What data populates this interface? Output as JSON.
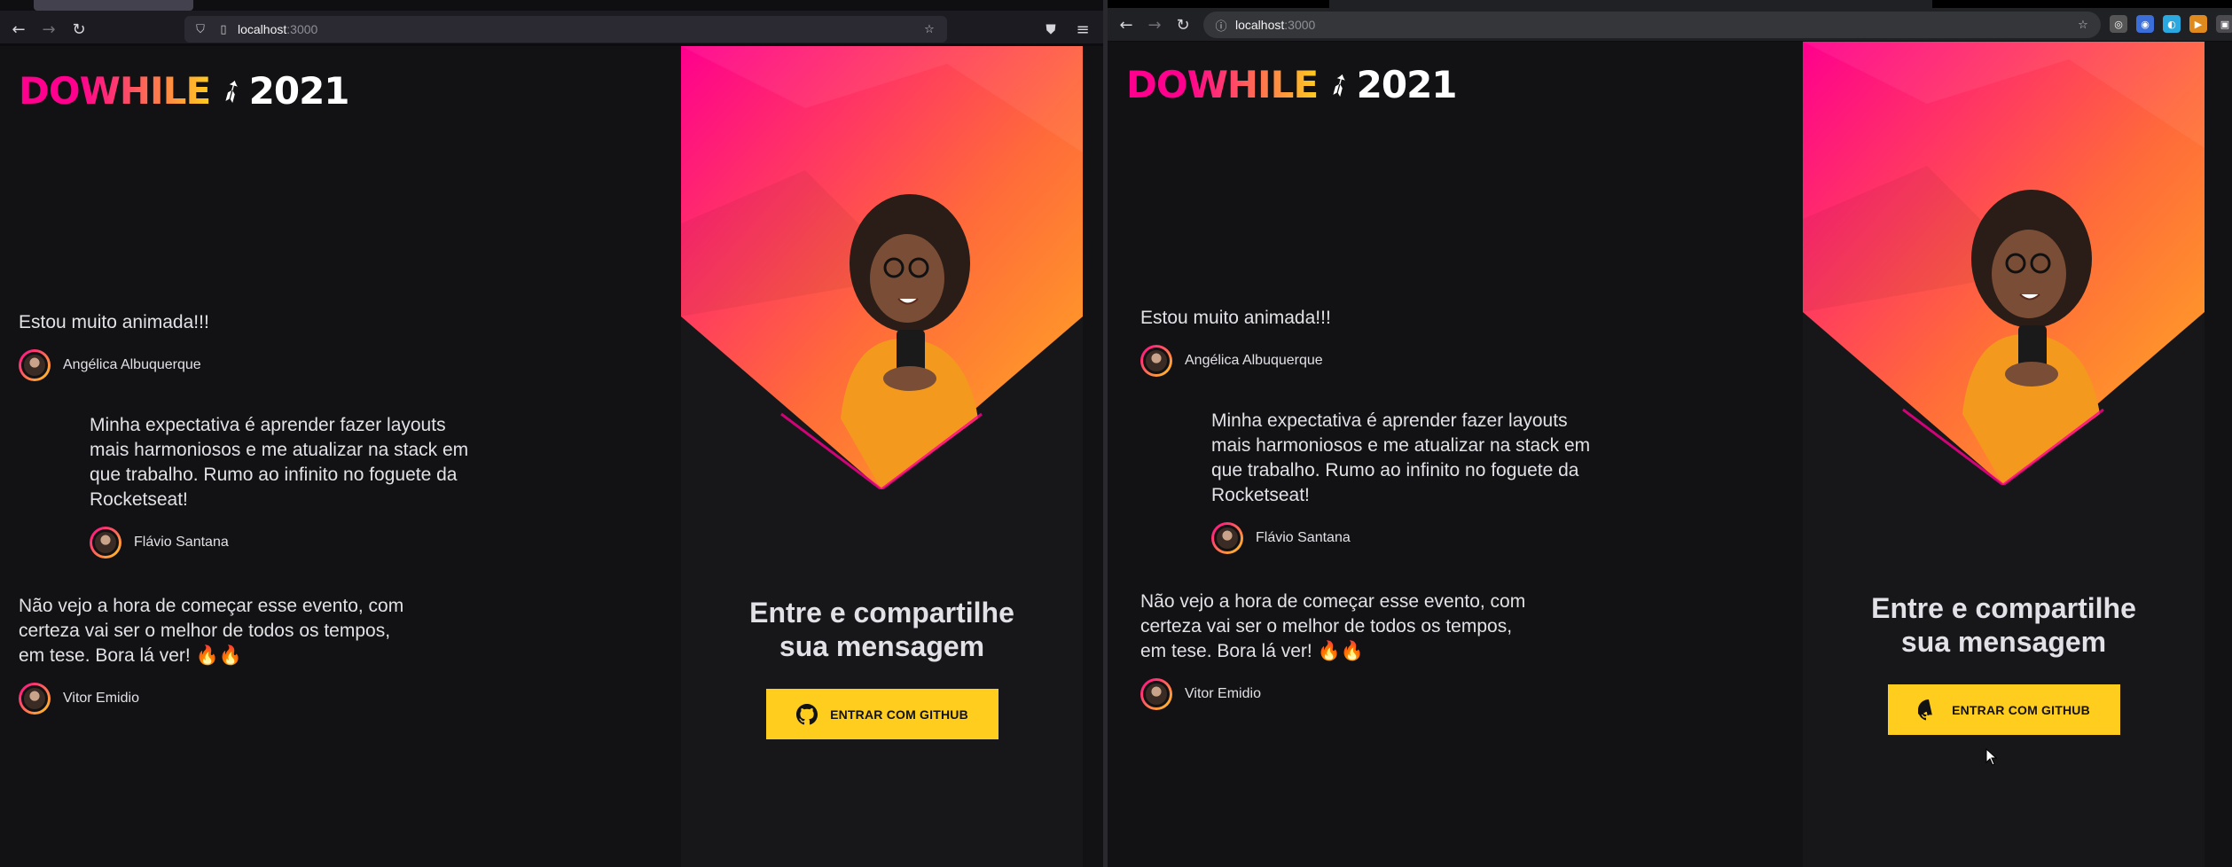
{
  "left_window": {
    "browser": "Firefox",
    "url_host": "localhost",
    "url_port": ":3000"
  },
  "right_window": {
    "browser": "Chrome",
    "url_host": "localhost",
    "url_port": ":3000"
  },
  "logo": {
    "do": "DO",
    "while": "WHILE",
    "year": "2021"
  },
  "messages": [
    {
      "text": "Estou muito animada!!!",
      "author": "Angélica Albuquerque"
    },
    {
      "text": "Minha expectativa é aprender fazer layouts mais harmoniosos e me atualizar na stack em que trabalho. Rumo ao infinito no foguete da Rocketseat!",
      "author": "Flávio Santana"
    },
    {
      "text": "Não vejo a hora de começar esse evento, com certeza vai ser o melhor de todos os tempos, em tese. Bora lá ver! 🔥🔥",
      "author": "Vitor Emidio"
    }
  ],
  "cta": {
    "title_line1": "Entre e compartilhe",
    "title_line2": "sua mensagem",
    "button": "ENTRAR COM GITHUB"
  },
  "colors": {
    "background": "#121214",
    "pink": "#ff008e",
    "yellow": "#ffcd1e",
    "orange": "#ff8a00"
  },
  "icons": {
    "back": "arrow-left-icon",
    "forward": "arrow-right-icon",
    "reload": "reload-icon",
    "star": "star-icon",
    "github": "github-icon"
  }
}
